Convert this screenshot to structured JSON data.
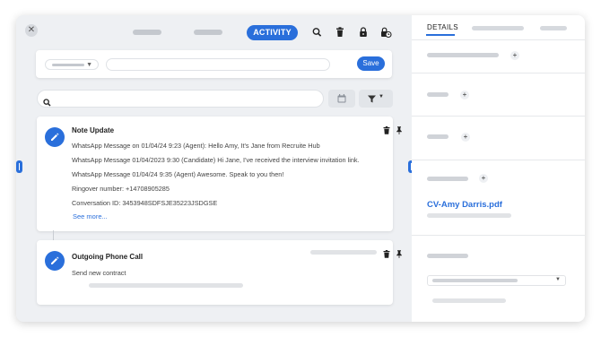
{
  "header": {
    "activity_label": "ACTIVITY"
  },
  "compose": {
    "save_label": "Save"
  },
  "activities": [
    {
      "title": "Note Update",
      "lines": [
        "WhatsApp Message on 01/04/24 9:23 (Agent): Hello Amy, It's Jane from Recruite Hub",
        "WhatsApp Message 01/04/2023 9:30 (Candidate) Hi Jane, I've received the interview invitation link.",
        "WhatsApp Message 01/04/24 9:35 (Agent) Awesome. Speak to you then!",
        "Ringover number: +14708905285",
        "Conversation ID: 3453948SDFSJE35223JSDGSE"
      ],
      "see_more": "See more..."
    },
    {
      "title": "Outgoing Phone Call",
      "lines": [
        "Send new contract"
      ]
    }
  ],
  "details": {
    "tab_label": "DETAILS",
    "file_link": "CV-Amy Darris.pdf"
  },
  "colors": {
    "accent": "#2a6fdb",
    "panel_bg": "#eef0f3",
    "placeholder": "#c4c8ce"
  },
  "icons": [
    "close-icon",
    "search-icon",
    "trash-icon",
    "lock-icon",
    "lock-clock-icon",
    "calendar-icon",
    "filter-icon",
    "pencil-icon",
    "pin-icon",
    "plus-icon",
    "chevron-down-icon"
  ]
}
